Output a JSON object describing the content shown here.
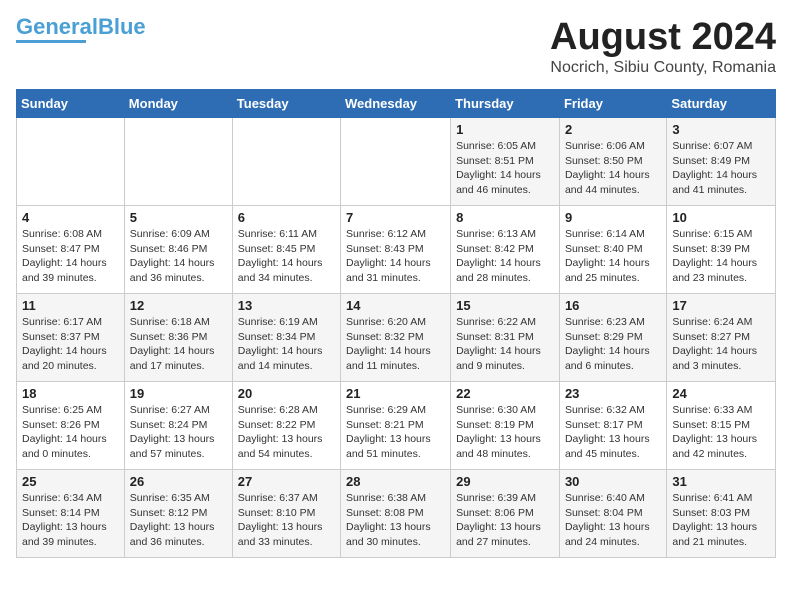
{
  "logo": {
    "part1": "General",
    "part2": "Blue"
  },
  "title": "August 2024",
  "subtitle": "Nocrich, Sibiu County, Romania",
  "weekdays": [
    "Sunday",
    "Monday",
    "Tuesday",
    "Wednesday",
    "Thursday",
    "Friday",
    "Saturday"
  ],
  "weeks": [
    [
      {
        "day": "",
        "info": ""
      },
      {
        "day": "",
        "info": ""
      },
      {
        "day": "",
        "info": ""
      },
      {
        "day": "",
        "info": ""
      },
      {
        "day": "1",
        "info": "Sunrise: 6:05 AM\nSunset: 8:51 PM\nDaylight: 14 hours\nand 46 minutes."
      },
      {
        "day": "2",
        "info": "Sunrise: 6:06 AM\nSunset: 8:50 PM\nDaylight: 14 hours\nand 44 minutes."
      },
      {
        "day": "3",
        "info": "Sunrise: 6:07 AM\nSunset: 8:49 PM\nDaylight: 14 hours\nand 41 minutes."
      }
    ],
    [
      {
        "day": "4",
        "info": "Sunrise: 6:08 AM\nSunset: 8:47 PM\nDaylight: 14 hours\nand 39 minutes."
      },
      {
        "day": "5",
        "info": "Sunrise: 6:09 AM\nSunset: 8:46 PM\nDaylight: 14 hours\nand 36 minutes."
      },
      {
        "day": "6",
        "info": "Sunrise: 6:11 AM\nSunset: 8:45 PM\nDaylight: 14 hours\nand 34 minutes."
      },
      {
        "day": "7",
        "info": "Sunrise: 6:12 AM\nSunset: 8:43 PM\nDaylight: 14 hours\nand 31 minutes."
      },
      {
        "day": "8",
        "info": "Sunrise: 6:13 AM\nSunset: 8:42 PM\nDaylight: 14 hours\nand 28 minutes."
      },
      {
        "day": "9",
        "info": "Sunrise: 6:14 AM\nSunset: 8:40 PM\nDaylight: 14 hours\nand 25 minutes."
      },
      {
        "day": "10",
        "info": "Sunrise: 6:15 AM\nSunset: 8:39 PM\nDaylight: 14 hours\nand 23 minutes."
      }
    ],
    [
      {
        "day": "11",
        "info": "Sunrise: 6:17 AM\nSunset: 8:37 PM\nDaylight: 14 hours\nand 20 minutes."
      },
      {
        "day": "12",
        "info": "Sunrise: 6:18 AM\nSunset: 8:36 PM\nDaylight: 14 hours\nand 17 minutes."
      },
      {
        "day": "13",
        "info": "Sunrise: 6:19 AM\nSunset: 8:34 PM\nDaylight: 14 hours\nand 14 minutes."
      },
      {
        "day": "14",
        "info": "Sunrise: 6:20 AM\nSunset: 8:32 PM\nDaylight: 14 hours\nand 11 minutes."
      },
      {
        "day": "15",
        "info": "Sunrise: 6:22 AM\nSunset: 8:31 PM\nDaylight: 14 hours\nand 9 minutes."
      },
      {
        "day": "16",
        "info": "Sunrise: 6:23 AM\nSunset: 8:29 PM\nDaylight: 14 hours\nand 6 minutes."
      },
      {
        "day": "17",
        "info": "Sunrise: 6:24 AM\nSunset: 8:27 PM\nDaylight: 14 hours\nand 3 minutes."
      }
    ],
    [
      {
        "day": "18",
        "info": "Sunrise: 6:25 AM\nSunset: 8:26 PM\nDaylight: 14 hours\nand 0 minutes."
      },
      {
        "day": "19",
        "info": "Sunrise: 6:27 AM\nSunset: 8:24 PM\nDaylight: 13 hours\nand 57 minutes."
      },
      {
        "day": "20",
        "info": "Sunrise: 6:28 AM\nSunset: 8:22 PM\nDaylight: 13 hours\nand 54 minutes."
      },
      {
        "day": "21",
        "info": "Sunrise: 6:29 AM\nSunset: 8:21 PM\nDaylight: 13 hours\nand 51 minutes."
      },
      {
        "day": "22",
        "info": "Sunrise: 6:30 AM\nSunset: 8:19 PM\nDaylight: 13 hours\nand 48 minutes."
      },
      {
        "day": "23",
        "info": "Sunrise: 6:32 AM\nSunset: 8:17 PM\nDaylight: 13 hours\nand 45 minutes."
      },
      {
        "day": "24",
        "info": "Sunrise: 6:33 AM\nSunset: 8:15 PM\nDaylight: 13 hours\nand 42 minutes."
      }
    ],
    [
      {
        "day": "25",
        "info": "Sunrise: 6:34 AM\nSunset: 8:14 PM\nDaylight: 13 hours\nand 39 minutes."
      },
      {
        "day": "26",
        "info": "Sunrise: 6:35 AM\nSunset: 8:12 PM\nDaylight: 13 hours\nand 36 minutes."
      },
      {
        "day": "27",
        "info": "Sunrise: 6:37 AM\nSunset: 8:10 PM\nDaylight: 13 hours\nand 33 minutes."
      },
      {
        "day": "28",
        "info": "Sunrise: 6:38 AM\nSunset: 8:08 PM\nDaylight: 13 hours\nand 30 minutes."
      },
      {
        "day": "29",
        "info": "Sunrise: 6:39 AM\nSunset: 8:06 PM\nDaylight: 13 hours\nand 27 minutes."
      },
      {
        "day": "30",
        "info": "Sunrise: 6:40 AM\nSunset: 8:04 PM\nDaylight: 13 hours\nand 24 minutes."
      },
      {
        "day": "31",
        "info": "Sunrise: 6:41 AM\nSunset: 8:03 PM\nDaylight: 13 hours\nand 21 minutes."
      }
    ]
  ]
}
